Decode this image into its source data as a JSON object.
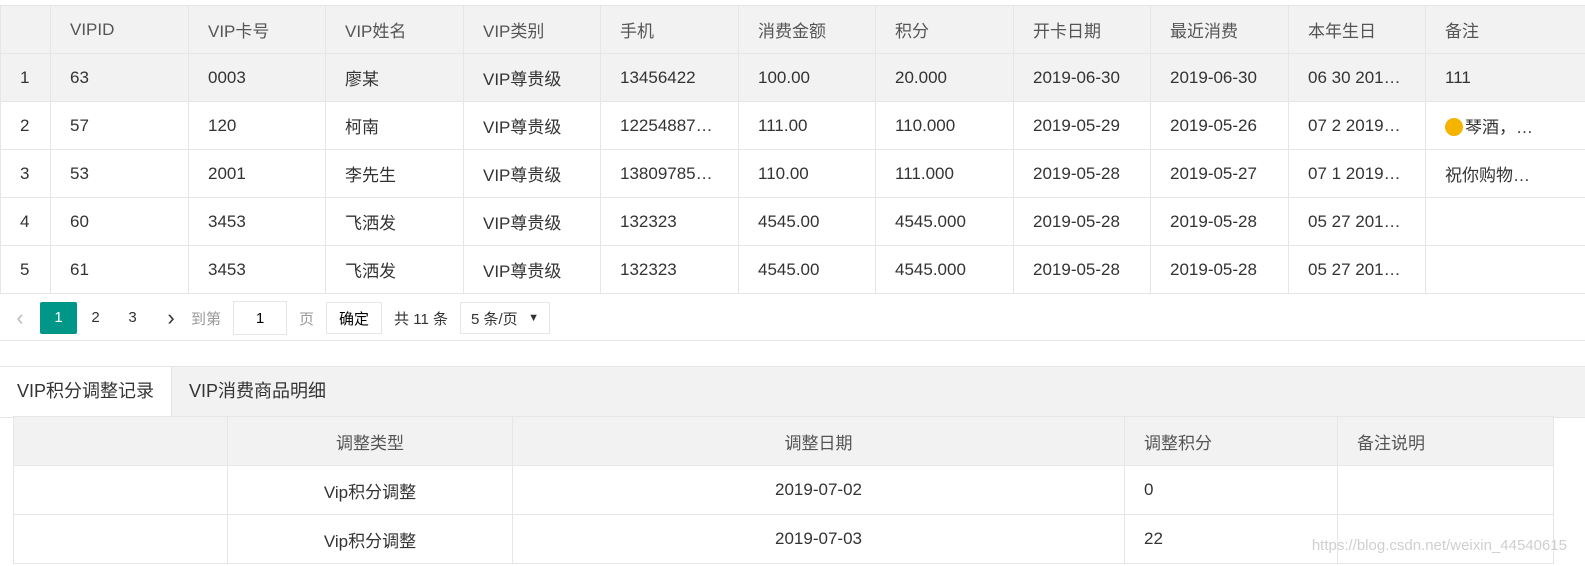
{
  "vip_table": {
    "headers": [
      "",
      "VIPID",
      "VIP卡号",
      "VIP姓名",
      "VIP类别",
      "手机",
      "消费金额",
      "积分",
      "开卡日期",
      "最近消费",
      "本年生日",
      "备注"
    ],
    "rows": [
      [
        "1",
        "63",
        "0003",
        "廖某",
        "VIP尊贵级",
        "13456422",
        "100.00",
        "20.000",
        "2019-06-30",
        "2019-06-30",
        "06 30 201…",
        "111"
      ],
      [
        "2",
        "57",
        "120",
        "柯南",
        "VIP尊贵级",
        "12254887…",
        "111.00",
        "110.000",
        "2019-05-29",
        "2019-05-26",
        "07 2 2019…",
        "琴酒，…"
      ],
      [
        "3",
        "53",
        "2001",
        "李先生",
        "VIP尊贵级",
        "13809785…",
        "110.00",
        "111.000",
        "2019-05-28",
        "2019-05-27",
        "07 1 2019…",
        "祝你购物…"
      ],
      [
        "4",
        "60",
        "3453",
        "飞洒发",
        "VIP尊贵级",
        "132323",
        "4545.00",
        "4545.000",
        "2019-05-28",
        "2019-05-28",
        "05 27 201…",
        ""
      ],
      [
        "5",
        "61",
        "3453",
        "飞洒发",
        "VIP尊贵级",
        "132323",
        "4545.00",
        "4545.000",
        "2019-05-28",
        "2019-05-28",
        "05 27 201…",
        ""
      ]
    ]
  },
  "pager": {
    "prev_icon": "chevron-left-icon",
    "pages": [
      "1",
      "2",
      "3"
    ],
    "current": "1",
    "next_icon": "chevron-right-icon",
    "goto_label": "到第",
    "goto_value": "1",
    "page_label": "页",
    "confirm_label": "确定",
    "total_label": "共 11 条",
    "page_size": "5 条/页"
  },
  "tabs": [
    "VIP积分调整记录",
    "VIP消费商品明细"
  ],
  "adjust_table": {
    "headers": [
      "",
      "调整类型",
      "调整日期",
      "调整积分",
      "备注说明"
    ],
    "rows": [
      [
        "",
        "Vip积分调整",
        "2019-07-02",
        "0",
        ""
      ],
      [
        "",
        "Vip积分调整",
        "2019-07-03",
        "22",
        ""
      ]
    ]
  },
  "watermark": "https://blog.csdn.net/weixin_44540615"
}
